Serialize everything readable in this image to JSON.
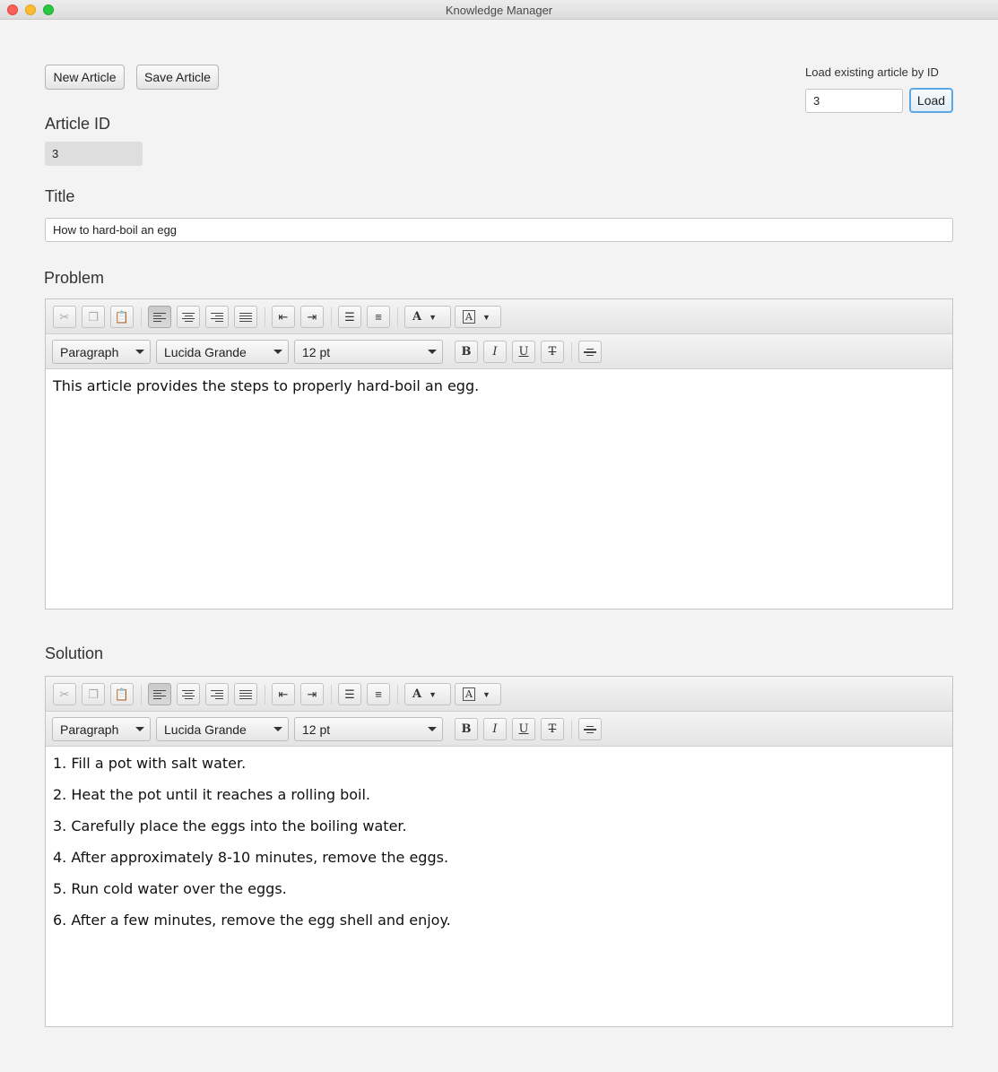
{
  "window": {
    "title": "Knowledge Manager"
  },
  "toolbar": {
    "new_label": "New Article",
    "save_label": "Save Article"
  },
  "load": {
    "label": "Load existing article by ID",
    "value": "3",
    "button_label": "Load"
  },
  "article_id": {
    "label": "Article ID",
    "value": "3"
  },
  "title_field": {
    "label": "Title",
    "value": "How to hard-boil an egg"
  },
  "problem": {
    "label": "Problem",
    "format": {
      "style": "Paragraph",
      "font": "Lucida Grande",
      "size": "12 pt"
    },
    "paragraphs": [
      "This article provides the steps to properly hard-boil an egg."
    ]
  },
  "solution": {
    "label": "Solution",
    "format": {
      "style": "Paragraph",
      "font": "Lucida Grande",
      "size": "12 pt"
    },
    "paragraphs": [
      "1. Fill a pot with salt water.",
      "2. Heat the pot until it reaches a rolling boil.",
      "3. Carefully place the eggs into the boiling water.",
      "4. After approximately 8-10 minutes, remove the eggs.",
      "5. Run cold water over the eggs.",
      "6. After a few minutes, remove the egg shell and enjoy."
    ]
  },
  "editor_icons": [
    "cut-icon",
    "copy-icon",
    "paste-icon",
    "align-left-icon",
    "align-center-icon",
    "align-right-icon",
    "align-justify-icon",
    "outdent-icon",
    "indent-icon",
    "bullet-list-icon",
    "numbered-list-icon",
    "text-color-icon",
    "background-color-icon",
    "bold-icon",
    "italic-icon",
    "underline-icon",
    "strikethrough-icon",
    "horizontal-rule-icon"
  ],
  "colors": {
    "accent": "#5da7e4",
    "background": "#f3f3f3"
  }
}
